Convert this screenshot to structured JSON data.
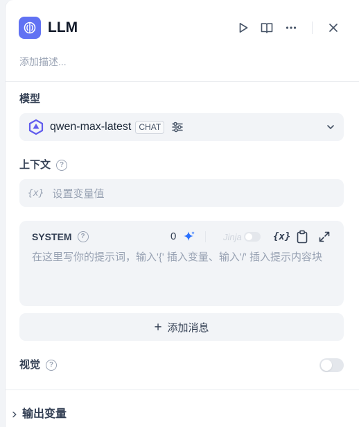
{
  "node": {
    "title": "LLM",
    "description_placeholder": "添加描述...",
    "icon": "brain-icon",
    "accent_color": "#6172f3"
  },
  "header_actions": [
    "play-icon",
    "book-open-icon",
    "more-icon",
    "close-icon"
  ],
  "model": {
    "label": "模型",
    "name": "qwen-max-latest",
    "mode_badge": "CHAT",
    "provider_icon": "qwen-logo-icon"
  },
  "context": {
    "label": "上下文",
    "variable_icon_text": "{x}",
    "placeholder": "设置变量值"
  },
  "prompt": {
    "role": "SYSTEM",
    "token_count": "0",
    "jinja_label": "Jinja",
    "jinja_enabled": false,
    "variable_icon_text": "{x}",
    "placeholder": "在这里写你的提示词，输入'{' 插入变量、输入'/' 插入提示内容块"
  },
  "add_message": {
    "plus": "+",
    "label": "添加消息"
  },
  "vision": {
    "label": "视觉",
    "enabled": false
  },
  "output": {
    "label": "输出变量"
  }
}
